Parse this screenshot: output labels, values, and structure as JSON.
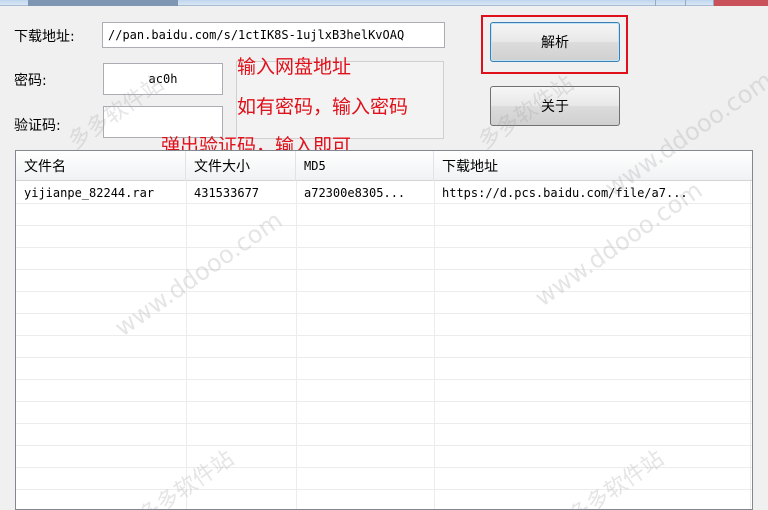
{
  "form": {
    "url_label": "下载地址:",
    "url_value": "//pan.baidu.com/s/1ctIK8S-1ujlxB3helKvOAQ",
    "password_label": "密码:",
    "password_value": "ac0h",
    "captcha_label": "验证码:",
    "captcha_value": ""
  },
  "buttons": {
    "parse_label": "解析",
    "about_label": "关于"
  },
  "annotations": {
    "line1": "输入网盘地址",
    "line2": "如有密码，输入密码",
    "line3": "弹出验证码，输入即可"
  },
  "table": {
    "columns": [
      "文件名",
      "文件大小",
      "MD5",
      "下载地址"
    ],
    "rows": [
      {
        "name": "yijianpe_82244.rar",
        "size": "431533677",
        "md5": "a72300e8305...",
        "url": "https://d.pcs.baidu.com/file/a7..."
      }
    ]
  },
  "watermark": {
    "text": "多多软件站",
    "domain": "www.ddooo.com"
  },
  "colors": {
    "annotation_red": "#e0101a",
    "window_bg": "#f0f0f0"
  }
}
